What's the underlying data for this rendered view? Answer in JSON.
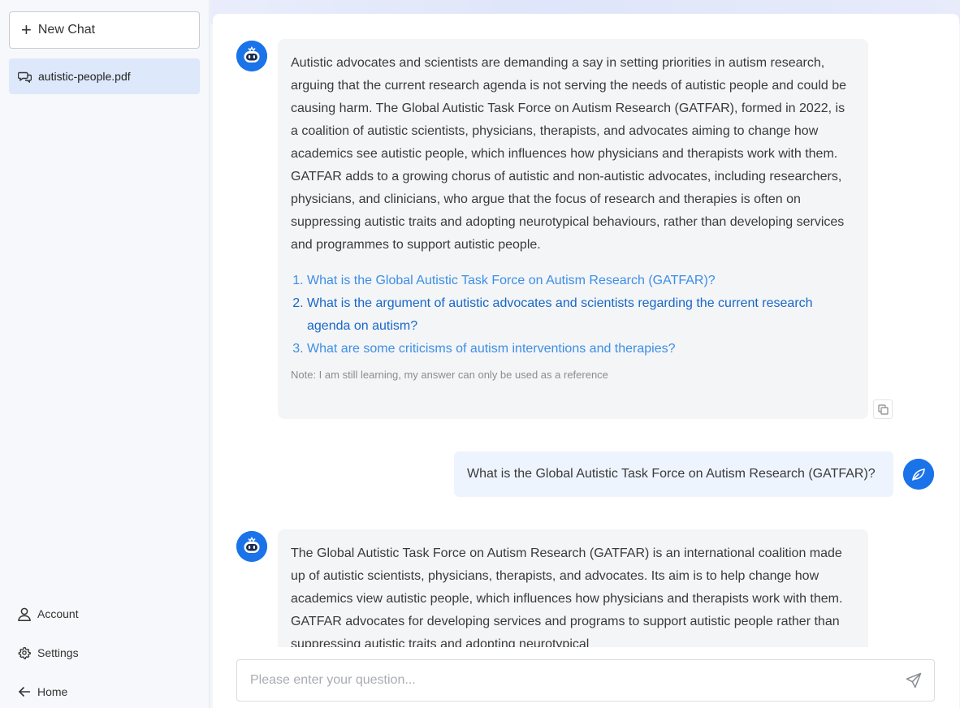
{
  "sidebar": {
    "new_chat_label": "New Chat",
    "chat_items": [
      {
        "label": "autistic-people.pdf"
      }
    ],
    "account_label": "Account",
    "settings_label": "Settings",
    "home_label": "Home"
  },
  "conversation": {
    "bot_message_1": {
      "text": "Autistic advocates and scientists are demanding a say in setting priorities in autism research, arguing that the current research agenda is not serving the needs of autistic people and could be causing harm. The Global Autistic Task Force on Autism Research (GATFAR), formed in 2022, is a coalition of autistic scientists, physicians, therapists, and advocates aiming to change how academics see autistic people, which influences how physicians and therapists work with them. GATFAR adds to a growing chorus of autistic and non-autistic advocates, including researchers, physicians, and clinicians, who argue that the focus of research and therapies is often on suppressing autistic traits and adopting neurotypical behaviours, rather than developing services and programmes to support autistic people.",
      "suggestions": [
        "What is the Global Autistic Task Force on Autism Research (GATFAR)?",
        "What is the argument of autistic advocates and scientists regarding the current research agenda on autism?",
        "What are some criticisms of autism interventions and therapies?"
      ],
      "note": "Note: I am still learning, my answer can only be used as a reference"
    },
    "user_message_1": {
      "text": "What is the Global Autistic Task Force on Autism Research (GATFAR)?"
    },
    "bot_message_2": {
      "text": "The Global Autistic Task Force on Autism Research (GATFAR) is an international coalition made up of autistic scientists, physicians, therapists, and advocates. Its aim is to help change how academics view autistic people, which influences how physicians and therapists work with them. GATFAR advocates for developing services and programs to support autistic people rather than suppressing autistic traits and adopting neurotypical"
    }
  },
  "input": {
    "placeholder": "Please enter your question..."
  },
  "icons": {
    "new_chat": "plus-icon",
    "chat_item": "chat-bubbles-icon",
    "account": "user-icon",
    "settings": "gear-icon",
    "home": "arrow-left-icon",
    "copy": "copy-icon",
    "send": "paper-plane-icon",
    "bot_avatar": "robot-icon",
    "user_avatar": "leaf-icon"
  },
  "colors": {
    "accent": "#1a73e8",
    "link": "#3d8ee6",
    "link_active": "#1767c8",
    "selected_chat_bg": "#dde8fb",
    "bot_bubble_bg": "#f4f5f7",
    "user_bubble_bg": "#eef4fe"
  }
}
